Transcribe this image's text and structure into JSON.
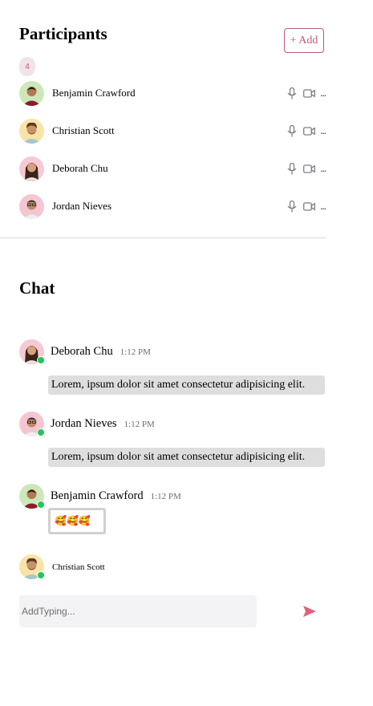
{
  "participants": {
    "title": "Participants",
    "add_label": "+ Add",
    "count": "4",
    "items": [
      {
        "name": "Benjamin Crawford",
        "avatar": "avatar-benjamin"
      },
      {
        "name": "Christian Scott",
        "avatar": "avatar-christian"
      },
      {
        "name": "Deborah Chu",
        "avatar": "avatar-deborah"
      },
      {
        "name": "Jordan Nieves",
        "avatar": "avatar-jordan"
      }
    ],
    "more_label": "..."
  },
  "chat": {
    "title": "Chat",
    "messages": [
      {
        "name": "Deborah Chu",
        "time": "1:12 PM",
        "text": "Lorem, ipsum dolor sit amet consectetur adipisicing elit."
      },
      {
        "name": "Jordan Nieves",
        "time": "1:12 PM",
        "text": "Lorem, ipsum dolor sit amet consectetur adipisicing elit."
      },
      {
        "name": "Benjamin Crawford",
        "time": "1:12 PM",
        "emojis": "🥰🥰🥰"
      }
    ],
    "typing": {
      "name": "Christian Scott"
    },
    "input_placeholder": "AddTyping..."
  },
  "colors": {
    "accent": "#c05b7a",
    "send": "#e0607e",
    "online": "#22c55e",
    "bubble": "#dedede"
  },
  "icons": {
    "mic": "microphone-icon",
    "video": "video-camera-icon",
    "send": "send-icon"
  }
}
